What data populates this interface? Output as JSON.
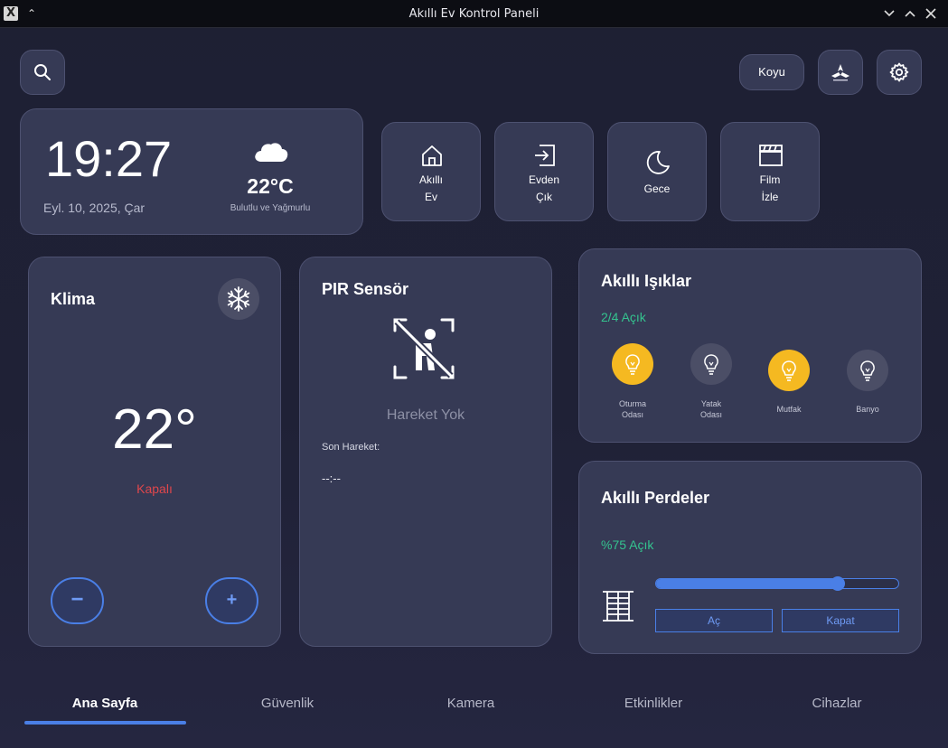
{
  "window": {
    "title": "Akıllı Ev Kontrol Paneli"
  },
  "header": {
    "theme_label": "Koyu"
  },
  "clock_card": {
    "time": "19:27",
    "date": "Eyl. 10, 2025, Çar",
    "temperature": "22°C",
    "weather": "Bulutlu ve Yağmurlu",
    "weather_icon": "cloud-icon"
  },
  "scenes": [
    {
      "line1": "Akıllı",
      "line2": "Ev",
      "icon": "home-icon"
    },
    {
      "line1": "Evden",
      "line2": "Çık",
      "icon": "exit-icon"
    },
    {
      "line1": "Gece",
      "line2": "",
      "icon": "moon-icon"
    },
    {
      "line1": "Film",
      "line2": "İzle",
      "icon": "clapperboard-icon"
    }
  ],
  "klima": {
    "title": "Klima",
    "temperature": "22°",
    "status": "Kapalı",
    "minus": "−",
    "plus": "+",
    "status_color": "#e0474c"
  },
  "pir": {
    "title": "PIR Sensör",
    "status": "Hareket Yok",
    "last_label": "Son Hareket:",
    "last_value": "--:--"
  },
  "lights": {
    "title": "Akıllı Işıklar",
    "summary": "2/4 Açık",
    "rooms": [
      {
        "line1": "Oturma",
        "line2": "Odası",
        "on": true
      },
      {
        "line1": "Yatak",
        "line2": "Odası",
        "on": false
      },
      {
        "line1": "Mutfak",
        "line2": "",
        "on": true
      },
      {
        "line1": "Banyo",
        "line2": "",
        "on": false
      }
    ]
  },
  "curtains": {
    "title": "Akıllı Perdeler",
    "summary": "%75 Açık",
    "level": 0.75,
    "open_label": "Aç",
    "close_label": "Kapat"
  },
  "tabs": [
    {
      "label": "Ana Sayfa",
      "active": true
    },
    {
      "label": "Güvenlik",
      "active": false
    },
    {
      "label": "Kamera",
      "active": false
    },
    {
      "label": "Etkinlikler",
      "active": false
    },
    {
      "label": "Cihazlar",
      "active": false
    }
  ],
  "colors": {
    "accent": "#4a7fe6",
    "green": "#34c38f",
    "bulb_on": "#f5b921",
    "card": "#363a55"
  }
}
